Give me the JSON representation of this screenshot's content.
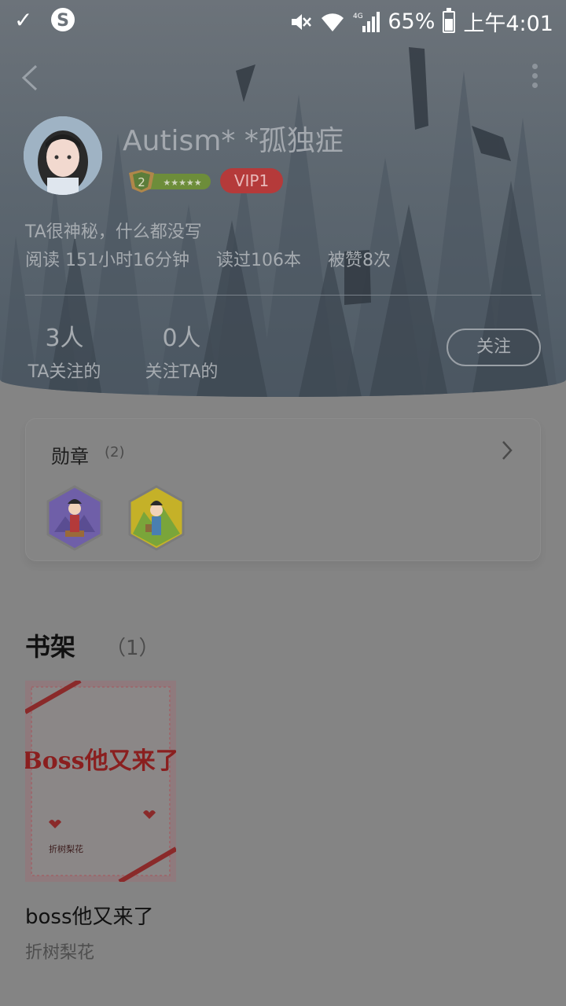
{
  "status_bar": {
    "battery_percent": "65%",
    "time": "上午4:01",
    "network": "4G"
  },
  "profile": {
    "username": "Autism* *孤独症",
    "level": "2",
    "vip": "VIP1",
    "bio": "TA很神秘，什么都没写",
    "reading_time": "阅读 151小时16分钟",
    "books_read": "读过106本",
    "likes": "被赞8次",
    "following_count": "3人",
    "following_label": "TA关注的",
    "followers_count": "0人",
    "followers_label": "关注TA的",
    "follow_button": "关注"
  },
  "badges": {
    "title": "勋章",
    "count": "(2)",
    "items": [
      {
        "icon": "opera-character-medal-icon",
        "color": "#6f5fa8"
      },
      {
        "icon": "scholar-character-medal-icon",
        "color": "#8ab03b"
      }
    ]
  },
  "bookshelf": {
    "title": "书架",
    "count": "（1）",
    "books": [
      {
        "title": "boss他又来了",
        "author": "折树梨花",
        "cover_text": "Boss他又来了"
      }
    ]
  }
}
